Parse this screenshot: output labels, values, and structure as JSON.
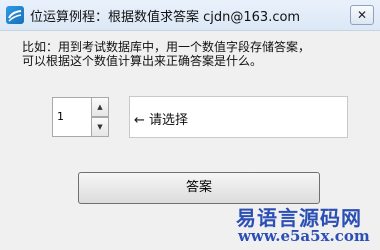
{
  "window": {
    "title": "位运算例程：根据数值求答案   cjdn@163.com",
    "close_symbol": "✕",
    "icon": "app-icon"
  },
  "content": {
    "description_line1": "比如：用到考试数据库中，用一个数值字段存储答案，",
    "description_line2": "可以根据这个数值计算出来正确答案是什么。",
    "spinner_value": "1",
    "spinner_up_symbol": "▲",
    "spinner_down_symbol": "▼",
    "result_text": "← 请选择",
    "answer_button_label": "答案"
  },
  "watermark": {
    "text_cn": "易语言源码网",
    "url": "www.e5a5x.com"
  },
  "colors": {
    "watermark": "#2b4fb5",
    "titlebar": "#dce8f6"
  }
}
